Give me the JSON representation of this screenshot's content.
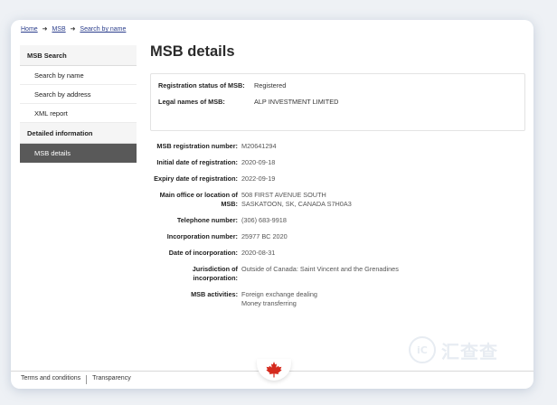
{
  "breadcrumb": {
    "home": "Home",
    "msb": "MSB",
    "search": "Search by name",
    "arrow": "➜"
  },
  "sidebar": {
    "section1": "MSB Search",
    "items": [
      "Search by name",
      "Search by address",
      "XML report"
    ],
    "section2": "Detailed information",
    "active_item": "MSB details"
  },
  "main": {
    "title": "MSB details",
    "summary": {
      "status_label": "Registration status of MSB:",
      "status_value": "Registered",
      "legal_label": "Legal names of MSB:",
      "legal_value": "ALP INVESTMENT LIMITED"
    },
    "details": {
      "reg_number_label": "MSB registration number:",
      "reg_number_value": "M20641294",
      "initial_label": "Initial date of registration:",
      "initial_value": "2020-09-18",
      "expiry_label": "Expiry date of registration:",
      "expiry_value": "2022-09-19",
      "office_label": "Main office or location of MSB:",
      "office_line1": "508 FIRST AVENUE SOUTH",
      "office_line2": "SASKATOON, SK, CANADA S7H0A3",
      "phone_label": "Telephone number:",
      "phone_value": "(306) 683-9918",
      "incorp_number_label": "Incorporation number:",
      "incorp_number_value": "25977 BC 2020",
      "incorp_date_label": "Date of incorporation:",
      "incorp_date_value": "2020-08-31",
      "jurisdiction_label": "Jurisdiction of incorporation:",
      "jurisdiction_value": "Outside of Canada: Saint Vincent and the Grenadines",
      "activities_label": "MSB activities:",
      "activity_1": "Foreign exchange dealing",
      "activity_2": "Money transferring"
    }
  },
  "footer": {
    "terms": "Terms and conditions",
    "transparency": "Transparency"
  },
  "watermark": {
    "text": "汇查查",
    "icon": "ic-logo-icon"
  },
  "colors": {
    "link": "#2b3e8c",
    "active_bg": "#595959",
    "leaf": "#d52b1e"
  }
}
